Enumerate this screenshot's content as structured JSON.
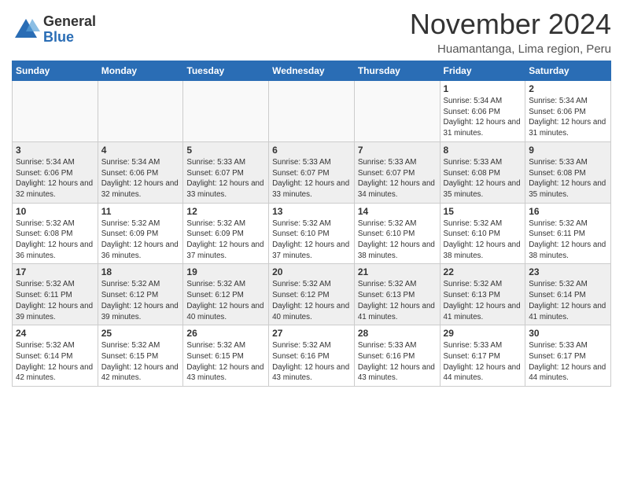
{
  "logo": {
    "general": "General",
    "blue": "Blue"
  },
  "title": {
    "month": "November 2024",
    "location": "Huamantanga, Lima region, Peru"
  },
  "weekdays": [
    "Sunday",
    "Monday",
    "Tuesday",
    "Wednesday",
    "Thursday",
    "Friday",
    "Saturday"
  ],
  "weeks": [
    [
      {
        "day": "",
        "info": ""
      },
      {
        "day": "",
        "info": ""
      },
      {
        "day": "",
        "info": ""
      },
      {
        "day": "",
        "info": ""
      },
      {
        "day": "",
        "info": ""
      },
      {
        "day": "1",
        "info": "Sunrise: 5:34 AM\nSunset: 6:06 PM\nDaylight: 12 hours and 31 minutes."
      },
      {
        "day": "2",
        "info": "Sunrise: 5:34 AM\nSunset: 6:06 PM\nDaylight: 12 hours and 31 minutes."
      }
    ],
    [
      {
        "day": "3",
        "info": "Sunrise: 5:34 AM\nSunset: 6:06 PM\nDaylight: 12 hours and 32 minutes."
      },
      {
        "day": "4",
        "info": "Sunrise: 5:34 AM\nSunset: 6:06 PM\nDaylight: 12 hours and 32 minutes."
      },
      {
        "day": "5",
        "info": "Sunrise: 5:33 AM\nSunset: 6:07 PM\nDaylight: 12 hours and 33 minutes."
      },
      {
        "day": "6",
        "info": "Sunrise: 5:33 AM\nSunset: 6:07 PM\nDaylight: 12 hours and 33 minutes."
      },
      {
        "day": "7",
        "info": "Sunrise: 5:33 AM\nSunset: 6:07 PM\nDaylight: 12 hours and 34 minutes."
      },
      {
        "day": "8",
        "info": "Sunrise: 5:33 AM\nSunset: 6:08 PM\nDaylight: 12 hours and 35 minutes."
      },
      {
        "day": "9",
        "info": "Sunrise: 5:33 AM\nSunset: 6:08 PM\nDaylight: 12 hours and 35 minutes."
      }
    ],
    [
      {
        "day": "10",
        "info": "Sunrise: 5:32 AM\nSunset: 6:08 PM\nDaylight: 12 hours and 36 minutes."
      },
      {
        "day": "11",
        "info": "Sunrise: 5:32 AM\nSunset: 6:09 PM\nDaylight: 12 hours and 36 minutes."
      },
      {
        "day": "12",
        "info": "Sunrise: 5:32 AM\nSunset: 6:09 PM\nDaylight: 12 hours and 37 minutes."
      },
      {
        "day": "13",
        "info": "Sunrise: 5:32 AM\nSunset: 6:10 PM\nDaylight: 12 hours and 37 minutes."
      },
      {
        "day": "14",
        "info": "Sunrise: 5:32 AM\nSunset: 6:10 PM\nDaylight: 12 hours and 38 minutes."
      },
      {
        "day": "15",
        "info": "Sunrise: 5:32 AM\nSunset: 6:10 PM\nDaylight: 12 hours and 38 minutes."
      },
      {
        "day": "16",
        "info": "Sunrise: 5:32 AM\nSunset: 6:11 PM\nDaylight: 12 hours and 38 minutes."
      }
    ],
    [
      {
        "day": "17",
        "info": "Sunrise: 5:32 AM\nSunset: 6:11 PM\nDaylight: 12 hours and 39 minutes."
      },
      {
        "day": "18",
        "info": "Sunrise: 5:32 AM\nSunset: 6:12 PM\nDaylight: 12 hours and 39 minutes."
      },
      {
        "day": "19",
        "info": "Sunrise: 5:32 AM\nSunset: 6:12 PM\nDaylight: 12 hours and 40 minutes."
      },
      {
        "day": "20",
        "info": "Sunrise: 5:32 AM\nSunset: 6:12 PM\nDaylight: 12 hours and 40 minutes."
      },
      {
        "day": "21",
        "info": "Sunrise: 5:32 AM\nSunset: 6:13 PM\nDaylight: 12 hours and 41 minutes."
      },
      {
        "day": "22",
        "info": "Sunrise: 5:32 AM\nSunset: 6:13 PM\nDaylight: 12 hours and 41 minutes."
      },
      {
        "day": "23",
        "info": "Sunrise: 5:32 AM\nSunset: 6:14 PM\nDaylight: 12 hours and 41 minutes."
      }
    ],
    [
      {
        "day": "24",
        "info": "Sunrise: 5:32 AM\nSunset: 6:14 PM\nDaylight: 12 hours and 42 minutes."
      },
      {
        "day": "25",
        "info": "Sunrise: 5:32 AM\nSunset: 6:15 PM\nDaylight: 12 hours and 42 minutes."
      },
      {
        "day": "26",
        "info": "Sunrise: 5:32 AM\nSunset: 6:15 PM\nDaylight: 12 hours and 43 minutes."
      },
      {
        "day": "27",
        "info": "Sunrise: 5:32 AM\nSunset: 6:16 PM\nDaylight: 12 hours and 43 minutes."
      },
      {
        "day": "28",
        "info": "Sunrise: 5:33 AM\nSunset: 6:16 PM\nDaylight: 12 hours and 43 minutes."
      },
      {
        "day": "29",
        "info": "Sunrise: 5:33 AM\nSunset: 6:17 PM\nDaylight: 12 hours and 44 minutes."
      },
      {
        "day": "30",
        "info": "Sunrise: 5:33 AM\nSunset: 6:17 PM\nDaylight: 12 hours and 44 minutes."
      }
    ]
  ]
}
